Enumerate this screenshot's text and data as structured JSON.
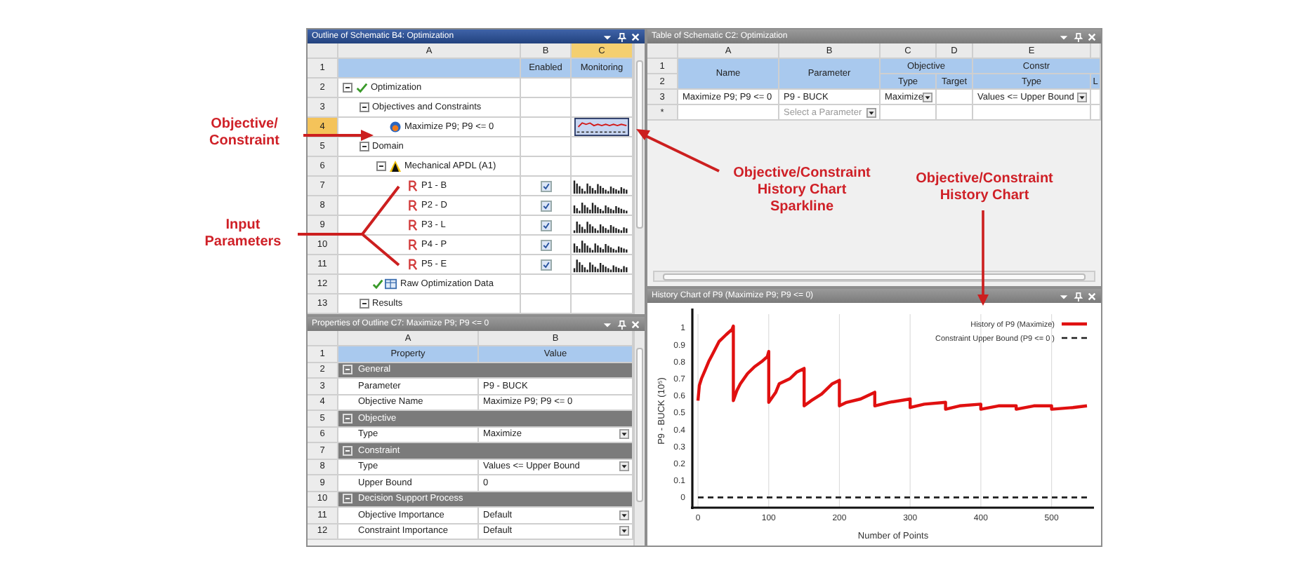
{
  "annotations": [
    {
      "text": "Objective/\nConstraint"
    },
    {
      "text": "Input\nParameters"
    },
    {
      "text": "Objective/Constraint\nHistory Chart\nSparkline"
    },
    {
      "text": "Objective/Constraint\nHistory Chart"
    }
  ],
  "outline": {
    "title": "Outline of Schematic B4: Optimization",
    "active": true,
    "columns": [
      {
        "label": "A",
        "selected": false
      },
      {
        "label": "B",
        "selected": false
      },
      {
        "label": "C",
        "selected": true
      }
    ],
    "header_row": "1",
    "enabled_header": "Enabled",
    "monitoring_header": "Monitoring",
    "tree": [
      {
        "row": "2",
        "kind": "optimization",
        "label": "Optimization",
        "expanded": true,
        "selected": false,
        "children": [
          {
            "row": "3",
            "kind": "folder",
            "label": "Objectives and Constraints",
            "expanded": true,
            "selected": false,
            "children": [
              {
                "row": "4",
                "kind": "objective",
                "label": "Maximize P9; P9 <= 0",
                "selected": true,
                "monitoring": true
              }
            ]
          },
          {
            "row": "5",
            "kind": "folder",
            "label": "Domain",
            "expanded": true,
            "selected": false,
            "children": [
              {
                "row": "6",
                "kind": "system",
                "label": "Mechanical APDL (A1)",
                "expanded": true,
                "selected": false,
                "children": [
                  {
                    "row": "7",
                    "kind": "parameter",
                    "label": "P1 - B",
                    "selected": false,
                    "enabled": true,
                    "monitoring": true
                  },
                  {
                    "row": "8",
                    "kind": "parameter",
                    "label": "P2 - D",
                    "selected": false,
                    "enabled": true,
                    "monitoring": true
                  },
                  {
                    "row": "9",
                    "kind": "parameter",
                    "label": "P3 - L",
                    "selected": false,
                    "enabled": true,
                    "monitoring": true
                  },
                  {
                    "row": "10",
                    "kind": "parameter",
                    "label": "P4 - P",
                    "selected": false,
                    "enabled": true,
                    "monitoring": true
                  },
                  {
                    "row": "11",
                    "kind": "parameter",
                    "label": "P5 - E",
                    "selected": false,
                    "enabled": true,
                    "monitoring": true
                  }
                ]
              }
            ]
          },
          {
            "row": "12",
            "kind": "data",
            "label": "Raw Optimization Data",
            "selected": false
          },
          {
            "row": "13",
            "kind": "folder",
            "label": "Results",
            "expanded": true,
            "selected": false
          }
        ]
      }
    ]
  },
  "properties": {
    "title": "Properties of Outline C7: Maximize P9; P9 <= 0",
    "active": false,
    "columns": [
      "A",
      "B"
    ],
    "header_row": "1",
    "property_header": "Property",
    "value_header": "Value",
    "rows": [
      {
        "row": "2",
        "kind": "section",
        "label": "General",
        "expanded": true
      },
      {
        "row": "3",
        "kind": "property",
        "name": "Parameter",
        "value": "P9 - BUCK",
        "dropdown": false
      },
      {
        "row": "4",
        "kind": "property",
        "name": "Objective Name",
        "value": "Maximize P9; P9 <= 0",
        "dropdown": false
      },
      {
        "row": "5",
        "kind": "section",
        "label": "Objective",
        "expanded": true
      },
      {
        "row": "6",
        "kind": "property",
        "name": "Type",
        "value": "Maximize",
        "dropdown": true
      },
      {
        "row": "7",
        "kind": "section",
        "label": "Constraint",
        "expanded": true
      },
      {
        "row": "8",
        "kind": "property",
        "name": "Type",
        "value": "Values <= Upper Bound",
        "dropdown": true
      },
      {
        "row": "9",
        "kind": "property",
        "name": "Upper Bound",
        "value": "0",
        "dropdown": false
      },
      {
        "row": "10",
        "kind": "section",
        "label": "Decision Support Process",
        "expanded": true
      },
      {
        "row": "11",
        "kind": "property",
        "name": "Objective Importance",
        "value": "Default",
        "dropdown": true
      },
      {
        "row": "12",
        "kind": "property",
        "name": "Constraint Importance",
        "value": "Default",
        "dropdown": true
      }
    ]
  },
  "table": {
    "title": "Table of Schematic C2: Optimization",
    "active": false,
    "columns": [
      "A",
      "B",
      "C",
      "D",
      "E"
    ],
    "header_rows": [
      "1",
      "2"
    ],
    "name_header": "Name",
    "parameter_header": "Parameter",
    "groups": [
      {
        "label": "Objective",
        "subcolumns": [
          "Type",
          "Target"
        ]
      },
      {
        "label": "Constr",
        "subcolumns": [
          "Type",
          "L"
        ]
      }
    ],
    "rows": [
      {
        "row": "3",
        "name": "Maximize P9; P9 <= 0",
        "parameter": "P9 - BUCK",
        "objective_type": "Maximize",
        "constraint_type": "Values <= Upper Bound"
      }
    ],
    "new_row": {
      "row": "*",
      "parameter_placeholder": "Select a Parameter"
    }
  },
  "history_chart": {
    "title": "History Chart of P9 (Maximize P9; P9 <= 0)",
    "active": false,
    "chart_data": {
      "type": "line",
      "grid": true,
      "legend": true,
      "xlabel": "Number of Points",
      "ylabel": "P9 - BUCK (10⁵)",
      "x": [
        0,
        2,
        5,
        10,
        15,
        20,
        25,
        30,
        40,
        48,
        50,
        50,
        55,
        60,
        70,
        80,
        90,
        98,
        100,
        100,
        110,
        115,
        130,
        140,
        150,
        150,
        160,
        175,
        190,
        200,
        200,
        210,
        230,
        250,
        250,
        270,
        300,
        300,
        320,
        350,
        350,
        370,
        400,
        400,
        425,
        450,
        450,
        475,
        500,
        500,
        530,
        550
      ],
      "series": [
        {
          "name": "History of P9 (Maximize)",
          "color": "#e01010",
          "line_style": "solid",
          "values": [
            0.57,
            0.66,
            0.7,
            0.75,
            0.8,
            0.84,
            0.88,
            0.92,
            0.96,
            0.99,
            1.01,
            0.57,
            0.63,
            0.67,
            0.73,
            0.77,
            0.8,
            0.83,
            0.86,
            0.56,
            0.62,
            0.67,
            0.7,
            0.74,
            0.76,
            0.54,
            0.57,
            0.61,
            0.67,
            0.69,
            0.54,
            0.56,
            0.58,
            0.62,
            0.54,
            0.56,
            0.58,
            0.53,
            0.55,
            0.56,
            0.52,
            0.54,
            0.55,
            0.52,
            0.54,
            0.54,
            0.52,
            0.54,
            0.54,
            0.52,
            0.53,
            0.54
          ]
        },
        {
          "name": "Constraint Upper Bound (P9 <= 0 )",
          "color": "#202020",
          "line_style": "dashed",
          "values": [
            0,
            0,
            0,
            0,
            0,
            0,
            0,
            0,
            0,
            0,
            0,
            0,
            0,
            0,
            0,
            0,
            0,
            0,
            0,
            0,
            0,
            0,
            0,
            0,
            0,
            0,
            0,
            0,
            0,
            0,
            0,
            0,
            0,
            0,
            0,
            0,
            0,
            0,
            0,
            0,
            0,
            0,
            0,
            0,
            0,
            0,
            0,
            0,
            0,
            0,
            0,
            0
          ]
        }
      ],
      "xlim": [
        -8,
        560
      ],
      "ylim": [
        -0.06,
        1.08
      ],
      "xticks": [
        0,
        100,
        200,
        300,
        400,
        500
      ],
      "yticks": [
        0,
        0.1,
        0.2,
        0.3,
        0.4,
        0.5,
        0.6,
        0.7,
        0.8,
        0.9,
        1
      ]
    }
  }
}
